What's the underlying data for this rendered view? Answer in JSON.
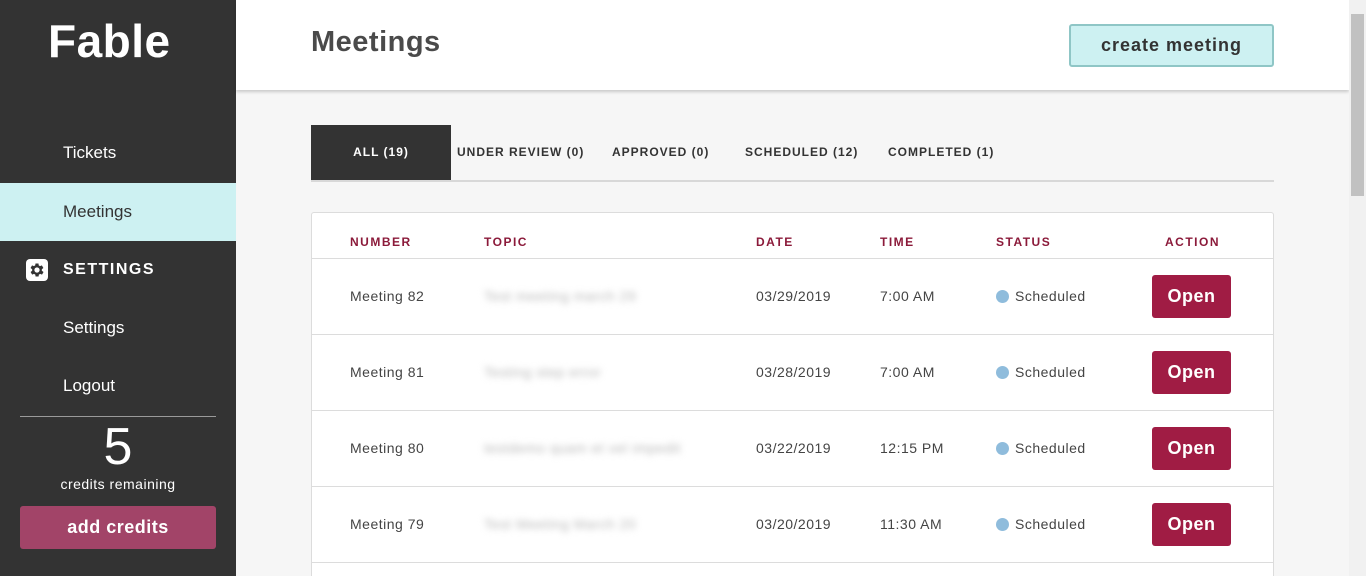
{
  "app": {
    "logo": "Fable"
  },
  "sidebar": {
    "items": [
      {
        "label": "Tickets"
      },
      {
        "label": "Meetings"
      }
    ],
    "section": {
      "label": "SETTINGS",
      "icon": "gear-icon"
    },
    "section_items": [
      {
        "label": "Settings"
      },
      {
        "label": "Logout"
      }
    ],
    "credits": {
      "count": "5",
      "label": "credits remaining"
    },
    "add_credits_label": "add credits"
  },
  "header": {
    "title": "Meetings",
    "create_label": "create meeting"
  },
  "tabs": [
    {
      "label": "ALL (19)",
      "active": true
    },
    {
      "label": "UNDER REVIEW (0)"
    },
    {
      "label": "APPROVED (0)"
    },
    {
      "label": "SCHEDULED (12)"
    },
    {
      "label": "COMPLETED (1)"
    }
  ],
  "table": {
    "columns": [
      "NUMBER",
      "TOPIC",
      "DATE",
      "TIME",
      "STATUS",
      "ACTION"
    ],
    "rows": [
      {
        "number": "Meeting 82",
        "topic": "Test meeting march 29",
        "date": "03/29/2019",
        "time": "7:00 AM",
        "status": "Scheduled",
        "action": "Open"
      },
      {
        "number": "Meeting 81",
        "topic": "Testing step error",
        "date": "03/28/2019",
        "time": "7:00 AM",
        "status": "Scheduled",
        "action": "Open"
      },
      {
        "number": "Meeting 80",
        "topic": "testdemo quam et vel impedit",
        "date": "03/22/2019",
        "time": "12:15 PM",
        "status": "Scheduled",
        "action": "Open"
      },
      {
        "number": "Meeting 79",
        "topic": "Test Meeting March 20",
        "date": "03/20/2019",
        "time": "11:30 AM",
        "status": "Scheduled",
        "action": "Open"
      }
    ]
  },
  "colors": {
    "sidebar_bg": "#333333",
    "active_nav": "#cdf1f2",
    "accent": "#a01c44",
    "add_credits": "#a24468",
    "status_scheduled": "#8fbcdc"
  }
}
